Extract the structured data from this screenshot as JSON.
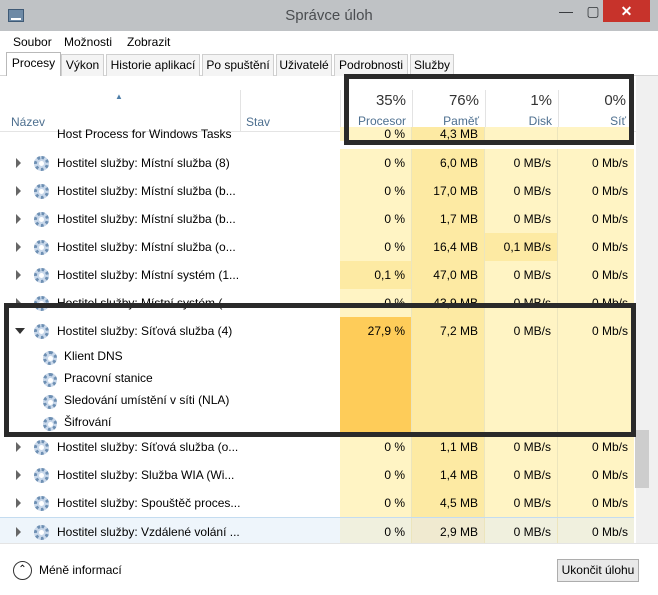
{
  "window": {
    "title": "Správce úloh",
    "minimize": "—",
    "maximize": "▢",
    "close": "✕"
  },
  "menu": [
    "Soubor",
    "Možnosti",
    "Zobrazit"
  ],
  "tabs": [
    "Procesy",
    "Výkon",
    "Historie aplikací",
    "Po spuštění",
    "Uživatelé",
    "Podrobnosti",
    "Služby"
  ],
  "header": {
    "name": "Název",
    "status": "Stav",
    "cpu_pct": "35%",
    "cpu": "Procesor",
    "mem_pct": "76%",
    "mem": "Paměť",
    "disk_pct": "1%",
    "disk": "Disk",
    "net_pct": "0%",
    "net": "Síť"
  },
  "rows": [
    {
      "name": "Host Process for Windows Tasks",
      "cpu": "0 %",
      "mem": "4,3 MB",
      "disk": "",
      "net": ""
    },
    {
      "name": "Hostitel služby: Místní služba (8)",
      "cpu": "0 %",
      "mem": "6,0 MB",
      "disk": "0 MB/s",
      "net": "0 Mb/s"
    },
    {
      "name": "Hostitel služby: Místní služba (b...",
      "cpu": "0 %",
      "mem": "17,0 MB",
      "disk": "0 MB/s",
      "net": "0 Mb/s"
    },
    {
      "name": "Hostitel služby: Místní služba (b...",
      "cpu": "0 %",
      "mem": "1,7 MB",
      "disk": "0 MB/s",
      "net": "0 Mb/s"
    },
    {
      "name": "Hostitel služby: Místní služba (o...",
      "cpu": "0 %",
      "mem": "16,4 MB",
      "disk": "0,1 MB/s",
      "net": "0 Mb/s"
    },
    {
      "name": "Hostitel služby: Místní systém (1...",
      "cpu": "0,1 %",
      "mem": "47,0 MB",
      "disk": "0 MB/s",
      "net": "0 Mb/s"
    },
    {
      "name": "Hostitel služby: Místní systém (...",
      "cpu": "0 %",
      "mem": "43,9 MB",
      "disk": "0 MB/s",
      "net": "0 Mb/s"
    },
    {
      "name": "Hostitel služby: Síťová služba (4)",
      "cpu": "27,9 %",
      "mem": "7,2 MB",
      "disk": "0 MB/s",
      "net": "0 Mb/s"
    },
    {
      "name": "Klient DNS"
    },
    {
      "name": "Pracovní stanice"
    },
    {
      "name": "Sledování umístění v síti (NLA)"
    },
    {
      "name": "Šifrování"
    },
    {
      "name": "Hostitel služby: Síťová služba (o...",
      "cpu": "0 %",
      "mem": "1,1 MB",
      "disk": "0 MB/s",
      "net": "0 Mb/s"
    },
    {
      "name": "Hostitel služby: Služba WIA (Wi...",
      "cpu": "0 %",
      "mem": "1,4 MB",
      "disk": "0 MB/s",
      "net": "0 Mb/s"
    },
    {
      "name": "Hostitel služby: Spouštěč proces...",
      "cpu": "0 %",
      "mem": "4,5 MB",
      "disk": "0 MB/s",
      "net": "0 Mb/s"
    },
    {
      "name": "Hostitel služby: Vzdálené volání ...",
      "cpu": "0 %",
      "mem": "2,9 MB",
      "disk": "0 MB/s",
      "net": "0 Mb/s"
    }
  ],
  "footer": {
    "less_info": "Méně informací",
    "end_task": "Ukončit úlohu"
  },
  "colors": {
    "heat_light": "#fff4c4",
    "heat_mid": "#fdeaa3",
    "heat_high": "#fecc59",
    "highlight_box": "#2a2a2a"
  }
}
